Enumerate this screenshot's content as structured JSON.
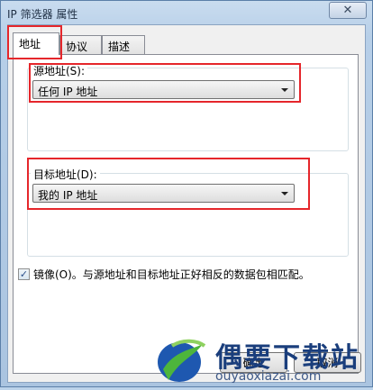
{
  "window": {
    "title": "IP 筛选器 属性",
    "close_glyph": "✕"
  },
  "tabs": [
    {
      "label": "地址"
    },
    {
      "label": "协议"
    },
    {
      "label": "描述"
    }
  ],
  "source": {
    "label": "源地址(S):",
    "value": "任何 IP 地址"
  },
  "destination": {
    "label": "目标地址(D):",
    "value": "我的 IP 地址"
  },
  "mirror": {
    "checked": true,
    "check_glyph": "✓",
    "label": "镜像(O)。与源地址和目标地址正好相反的数据包相匹配。"
  },
  "buttons": {
    "ok": "确定",
    "cancel": "取消"
  },
  "watermark": {
    "text": "偶要下载站",
    "url": "ouyaoxiazai.com"
  },
  "colors": {
    "highlight_red": "#e5262b",
    "watermark_blue": "#1a3e7c"
  }
}
